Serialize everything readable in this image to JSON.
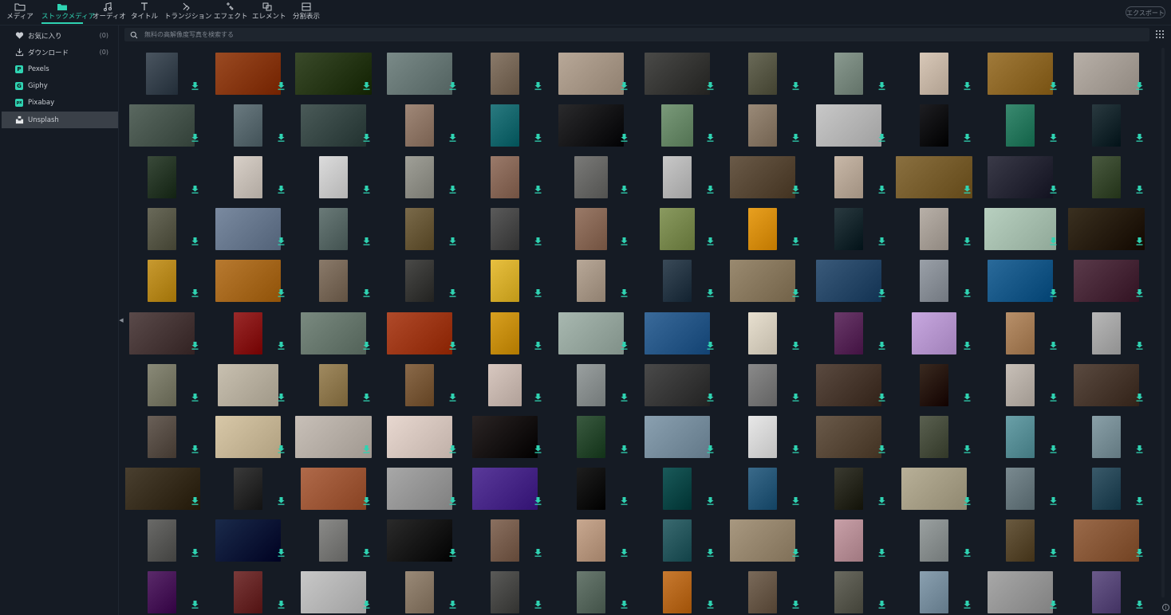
{
  "toolbar": {
    "tabs": [
      {
        "id": "media",
        "label": "メディア",
        "icon": "folder-icon",
        "active": false
      },
      {
        "id": "stock",
        "label": "ストックメディア",
        "icon": "stock-folder-icon",
        "active": true
      },
      {
        "id": "audio",
        "label": "オーディオ",
        "icon": "music-note-icon",
        "active": false
      },
      {
        "id": "title",
        "label": "タイトル",
        "icon": "text-t-icon",
        "active": false
      },
      {
        "id": "transition",
        "label": "トランジション",
        "icon": "transition-arrows-icon",
        "active": false
      },
      {
        "id": "effect",
        "label": "エフェクト",
        "icon": "effect-sparkle-icon",
        "active": false
      },
      {
        "id": "element",
        "label": "エレメント",
        "icon": "element-shapes-icon",
        "active": false
      },
      {
        "id": "split",
        "label": "分割表示",
        "icon": "split-screen-icon",
        "active": false
      }
    ],
    "export_label": "エクスポート"
  },
  "sidebar": {
    "items": [
      {
        "label": "お気に入り",
        "count": "(0)",
        "icon": "heart-icon",
        "active": false
      },
      {
        "label": "ダウンロード",
        "count": "(0)",
        "icon": "download-tray-icon",
        "active": false
      },
      {
        "label": "Pexels",
        "count": "",
        "icon": "pexels-logo-icon",
        "badge": "P",
        "badge_color": "#2fd3b2",
        "active": false
      },
      {
        "label": "Giphy",
        "count": "",
        "icon": "giphy-logo-icon",
        "badge": "G",
        "badge_color": "#2fd3b2",
        "active": false
      },
      {
        "label": "Pixabay",
        "count": "",
        "icon": "pixabay-logo-icon",
        "badge": "px",
        "badge_color": "#2fd3b2",
        "active": false
      },
      {
        "label": "Unsplash",
        "count": "",
        "icon": "unsplash-logo-icon",
        "active": true
      }
    ]
  },
  "search": {
    "placeholder": "無料の高解像度写真を検索する"
  },
  "colors": {
    "accent": "#2fd3b2",
    "background": "#151b24",
    "search_bg": "#1e252e",
    "active_item": "#3a4048"
  },
  "thumbnails": [
    [
      {
        "w": 40,
        "c": "#4a5560"
      },
      {
        "w": 82,
        "c": "#9a4a22"
      },
      {
        "w": 96,
        "c": "#3a4a2a"
      },
      {
        "w": 82,
        "c": "#7a8a88"
      },
      {
        "w": 36,
        "c": "#8a7a6a"
      },
      {
        "w": 82,
        "c": "#b8a898"
      },
      {
        "w": 82,
        "c": "#4a4a48"
      },
      {
        "w": 36,
        "c": "#6a6a58"
      },
      {
        "w": 36,
        "c": "#8a9a90"
      },
      {
        "w": 36,
        "c": "#d8c8b8"
      },
      {
        "w": 82,
        "c": "#a07a3a"
      },
      {
        "w": 82,
        "c": "#b8b0a8"
      }
    ],
    [
      {
        "w": 82,
        "c": "#5a6860"
      },
      {
        "w": 36,
        "c": "#6a7a80"
      },
      {
        "w": 82,
        "c": "#4a5a58"
      },
      {
        "w": 36,
        "c": "#a08878"
      },
      {
        "w": 36,
        "c": "#2a7a80"
      },
      {
        "w": 82,
        "c": "#2a2a2c"
      },
      {
        "w": 40,
        "c": "#7a9a7a"
      },
      {
        "w": 36,
        "c": "#9a8a78"
      },
      {
        "w": 82,
        "c": "#c8c8c8"
      },
      {
        "w": 36,
        "c": "#1e1e22"
      },
      {
        "w": 36,
        "c": "#3a8a70"
      },
      {
        "w": 36,
        "c": "#2a3a40"
      }
    ],
    [
      {
        "w": 36,
        "c": "#3a4a3a"
      },
      {
        "w": 36,
        "c": "#d8d0c8"
      },
      {
        "w": 36,
        "c": "#dcdcdc"
      },
      {
        "w": 36,
        "c": "#a0a098"
      },
      {
        "w": 36,
        "c": "#9a7a6a"
      },
      {
        "w": 42,
        "c": "#7a7a78"
      },
      {
        "w": 36,
        "c": "#c8c8c8"
      },
      {
        "w": 82,
        "c": "#6a5a48"
      },
      {
        "w": 36,
        "c": "#c8b8a8"
      },
      {
        "w": 96,
        "c": "#8a7040"
      },
      {
        "w": 82,
        "c": "#3a3a48"
      },
      {
        "w": 36,
        "c": "#4a5a40"
      }
    ],
    [
      {
        "w": 36,
        "c": "#6a6a5a"
      },
      {
        "w": 82,
        "c": "#7a8aa0"
      },
      {
        "w": 36,
        "c": "#6a7a78"
      },
      {
        "w": 36,
        "c": "#7a6a4a"
      },
      {
        "w": 36,
        "c": "#5a5a5a"
      },
      {
        "w": 40,
        "c": "#9a7a68"
      },
      {
        "w": 44,
        "c": "#8a9a60"
      },
      {
        "w": 36,
        "c": "#e8a020"
      },
      {
        "w": 36,
        "c": "#2a3a40"
      },
      {
        "w": 36,
        "c": "#b8b0a8"
      },
      {
        "w": 90,
        "c": "#b8d0c0"
      },
      {
        "w": 96,
        "c": "#3a3020"
      }
    ],
    [
      {
        "w": 36,
        "c": "#c89a30"
      },
      {
        "w": 82,
        "c": "#b87a30"
      },
      {
        "w": 36,
        "c": "#8a7a6a"
      },
      {
        "w": 36,
        "c": "#4a4a48"
      },
      {
        "w": 36,
        "c": "#e8c040"
      },
      {
        "w": 36,
        "c": "#b8a898"
      },
      {
        "w": 36,
        "c": "#3a4a58"
      },
      {
        "w": 82,
        "c": "#9a8a70"
      },
      {
        "w": 82,
        "c": "#3a5a7a"
      },
      {
        "w": 36,
        "c": "#9aa0a8"
      },
      {
        "w": 82,
        "c": "#2a6a9a"
      },
      {
        "w": 82,
        "c": "#5a3a4a"
      }
    ],
    [
      {
        "w": 82,
        "c": "#5a4a4a"
      },
      {
        "w": 36,
        "c": "#9a2a2a"
      },
      {
        "w": 82,
        "c": "#7a8a80"
      },
      {
        "w": 82,
        "c": "#b04a2a"
      },
      {
        "w": 36,
        "c": "#d8a020"
      },
      {
        "w": 82,
        "c": "#a8b8b0"
      },
      {
        "w": 82,
        "c": "#3a6a9a"
      },
      {
        "w": 36,
        "c": "#e8e0d0"
      },
      {
        "w": 36,
        "c": "#6a3a6a"
      },
      {
        "w": 56,
        "c": "#c8a8e0"
      },
      {
        "w": 36,
        "c": "#b8906a"
      },
      {
        "w": 36,
        "c": "#b8b8b8"
      }
    ],
    [
      {
        "w": 36,
        "c": "#8a8a78"
      },
      {
        "w": 76,
        "c": "#c8c0b0"
      },
      {
        "w": 36,
        "c": "#a08a60"
      },
      {
        "w": 36,
        "c": "#8a6a4a"
      },
      {
        "w": 42,
        "c": "#d8c8c0"
      },
      {
        "w": 36,
        "c": "#9aa0a0"
      },
      {
        "w": 82,
        "c": "#4a4a4a"
      },
      {
        "w": 36,
        "c": "#8a8a8a"
      },
      {
        "w": 82,
        "c": "#5a4a40"
      },
      {
        "w": 36,
        "c": "#3a2a20"
      },
      {
        "w": 36,
        "c": "#c8c0b8"
      },
      {
        "w": 82,
        "c": "#5a4a40"
      }
    ],
    [
      {
        "w": 36,
        "c": "#6a6058"
      },
      {
        "w": 82,
        "c": "#d8c8a8"
      },
      {
        "w": 96,
        "c": "#c8c0b8"
      },
      {
        "w": 82,
        "c": "#e8d8d0"
      },
      {
        "w": 82,
        "c": "#2a2424"
      },
      {
        "w": 36,
        "c": "#3a5a40"
      },
      {
        "w": 82,
        "c": "#8aa0b0"
      },
      {
        "w": 36,
        "c": "#e8e8e8"
      },
      {
        "w": 82,
        "c": "#6a5a4a"
      },
      {
        "w": 36,
        "c": "#5a6050"
      },
      {
        "w": 36,
        "c": "#6aa0a8"
      },
      {
        "w": 36,
        "c": "#8aa0a8"
      }
    ],
    [
      {
        "w": 96,
        "c": "#4a4030"
      },
      {
        "w": 36,
        "c": "#3a3a3a"
      },
      {
        "w": 82,
        "c": "#b06a4a"
      },
      {
        "w": 82,
        "c": "#a8a8a8"
      },
      {
        "w": 82,
        "c": "#5a3a9a"
      },
      {
        "w": 36,
        "c": "#1e1e1e"
      },
      {
        "w": 36,
        "c": "#1a5a5a"
      },
      {
        "w": 36,
        "c": "#3a6a8a"
      },
      {
        "w": 36,
        "c": "#3a3a30"
      },
      {
        "w": 82,
        "c": "#b8b098"
      },
      {
        "w": 36,
        "c": "#7a8a90"
      },
      {
        "w": 36,
        "c": "#3a5a6a"
      }
    ],
    [
      {
        "w": 36,
        "c": "#6a6a68"
      },
      {
        "w": 82,
        "c": "#1a2a4a"
      },
      {
        "w": 36,
        "c": "#8a8a88"
      },
      {
        "w": 82,
        "c": "#2a2a2a"
      },
      {
        "w": 36,
        "c": "#8a7060"
      },
      {
        "w": 36,
        "c": "#c8a890"
      },
      {
        "w": 36,
        "c": "#3a6a70"
      },
      {
        "w": 82,
        "c": "#a89880"
      },
      {
        "w": 36,
        "c": "#c8a0a8"
      },
      {
        "w": 36,
        "c": "#9aa0a0"
      },
      {
        "w": 36,
        "c": "#6a5a40"
      },
      {
        "w": 82,
        "c": "#9a6a4a"
      }
    ],
    [
      {
        "w": 36,
        "c": "#5a2a6a"
      },
      {
        "w": 36,
        "c": "#7a3a3a"
      },
      {
        "w": 82,
        "c": "#c8c8c8"
      },
      {
        "w": 36,
        "c": "#9a8a78"
      },
      {
        "w": 36,
        "c": "#5a5a58"
      },
      {
        "w": 36,
        "c": "#6a7a70"
      },
      {
        "w": 36,
        "c": "#c87a30"
      },
      {
        "w": 36,
        "c": "#7a6a5a"
      },
      {
        "w": 36,
        "c": "#6a6a60"
      },
      {
        "w": 36,
        "c": "#8aa0b0"
      },
      {
        "w": 82,
        "c": "#a8a8a8"
      },
      {
        "w": 36,
        "c": "#6a5a8a"
      }
    ]
  ]
}
